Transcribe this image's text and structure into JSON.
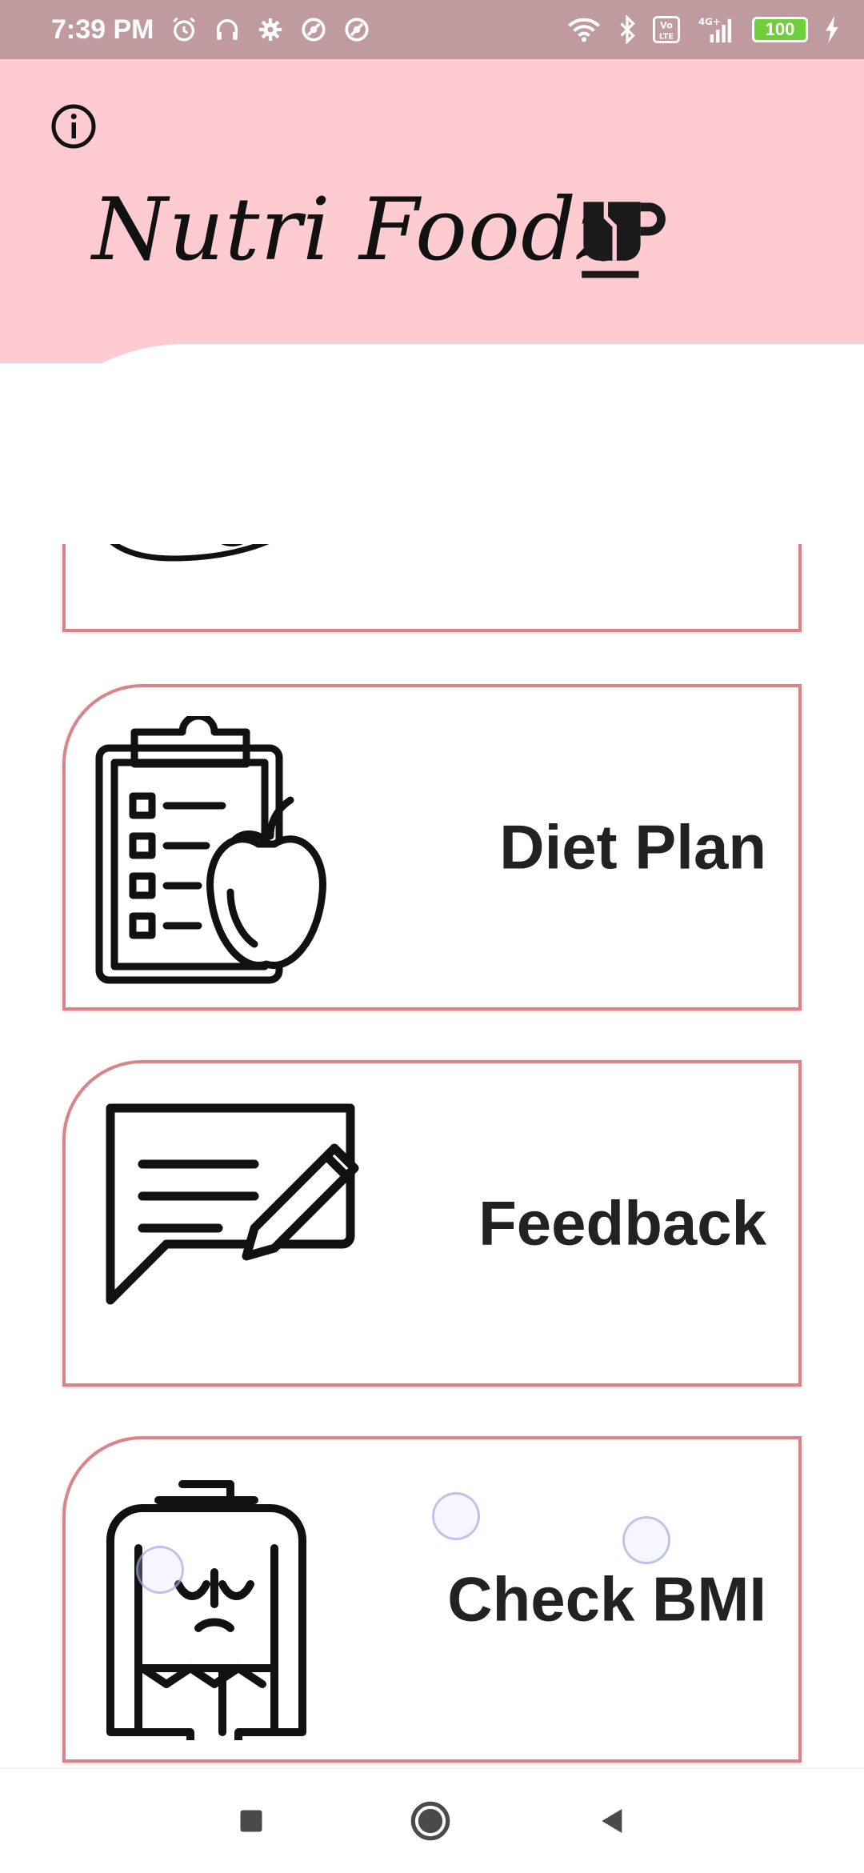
{
  "status_bar": {
    "time": "7:39 PM",
    "left_icons": [
      "alarm-icon",
      "headset-icon",
      "settings-icon",
      "sync-icon",
      "sync-icon"
    ],
    "right_icons": [
      "wifi-icon",
      "bluetooth-icon",
      "volte-icon",
      "signal-4g-icon",
      "battery-icon",
      "charging-icon"
    ],
    "battery": "100",
    "volte_label": "Vo LTE",
    "network_label": "4G+"
  },
  "header": {
    "title": "Nutri Foodz",
    "info_icon": "info-icon",
    "logo_icon": "coffee-cup-icon",
    "background": "#fdcbd0"
  },
  "cards": [
    {
      "label": "Diet Plan",
      "icon": "clipboard-apple-icon"
    },
    {
      "label": "Feedback",
      "icon": "chat-pencil-icon"
    },
    {
      "label": "Check BMI",
      "icon": "body-measure-icon"
    }
  ],
  "nav_bar": {
    "buttons": [
      "recents-button",
      "home-button",
      "back-button"
    ]
  },
  "colors": {
    "status_bar": "#bf9a9f",
    "card_border": "#d98489",
    "text": "#222222"
  }
}
